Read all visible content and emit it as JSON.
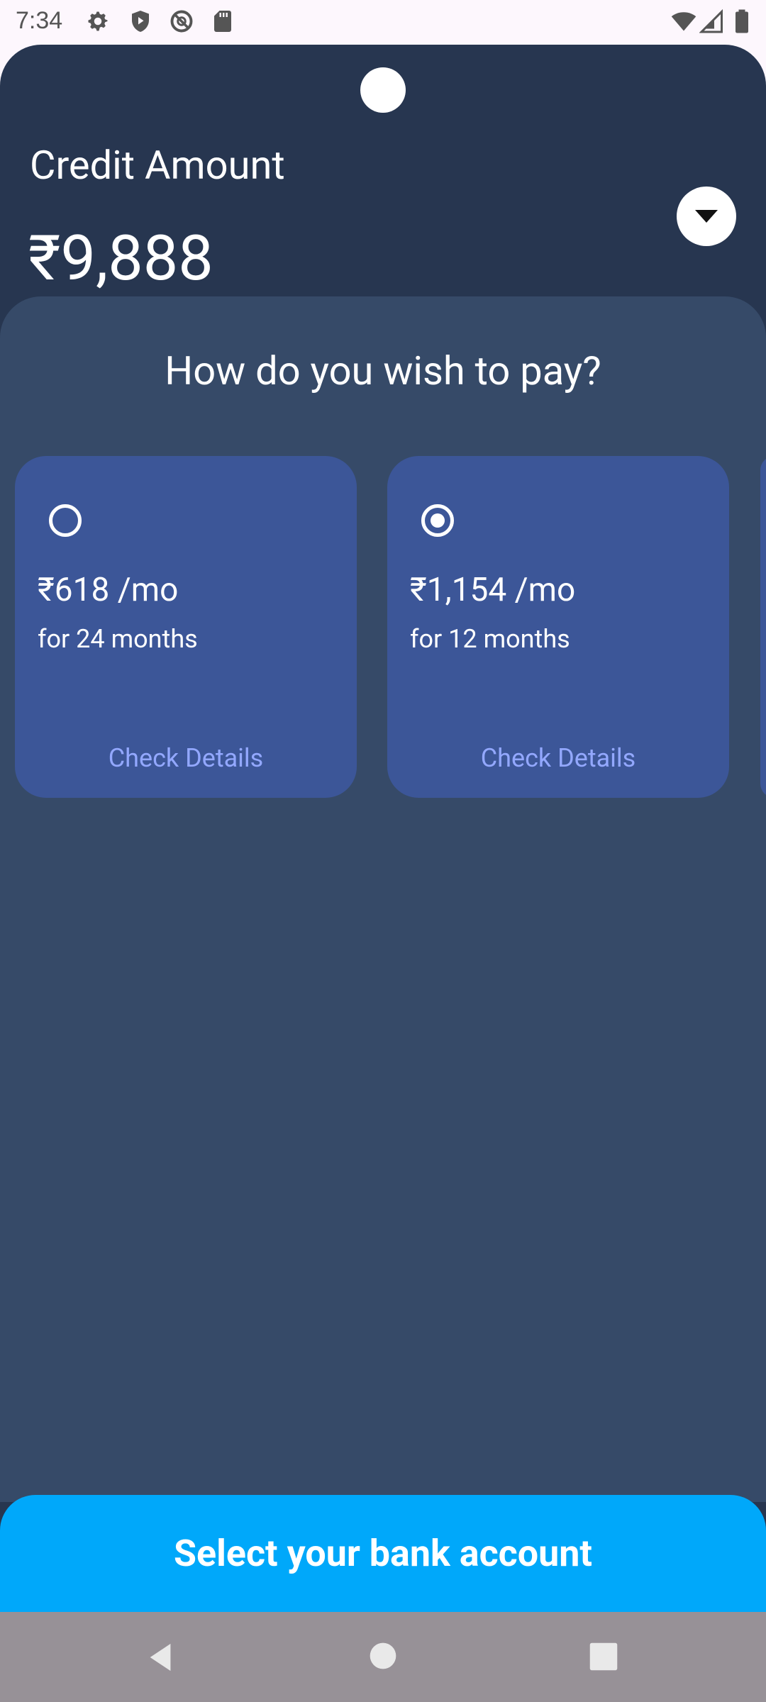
{
  "status_bar": {
    "time": "7:34",
    "left_icons": [
      "settings-icon",
      "shield-icon",
      "do-not-disturb-icon",
      "sd-card-icon"
    ],
    "right_icons": [
      "wifi-icon",
      "signal-icon",
      "battery-icon"
    ]
  },
  "header": {
    "label": "Credit Amount",
    "amount": "₹9,888",
    "dropdown_icon": "chevron-down-icon"
  },
  "payment": {
    "title": "How do you wish to pay?",
    "plans": [
      {
        "price": "₹618 /mo",
        "term": "for 24 months",
        "link": "Check Details",
        "selected": false
      },
      {
        "price": "₹1,154 /mo",
        "term": "for 12 months",
        "link": "Check Details",
        "selected": true
      }
    ]
  },
  "cta": {
    "label": "Select your bank account"
  },
  "nav_bar": {
    "icons": [
      "back-icon",
      "home-icon",
      "recents-icon"
    ]
  },
  "colors": {
    "sheet_bg": "#273650",
    "panel_bg": "#364a68",
    "card_bg": "#3c5698",
    "link": "#93a8ff",
    "cta_bg": "#00a8fa"
  }
}
